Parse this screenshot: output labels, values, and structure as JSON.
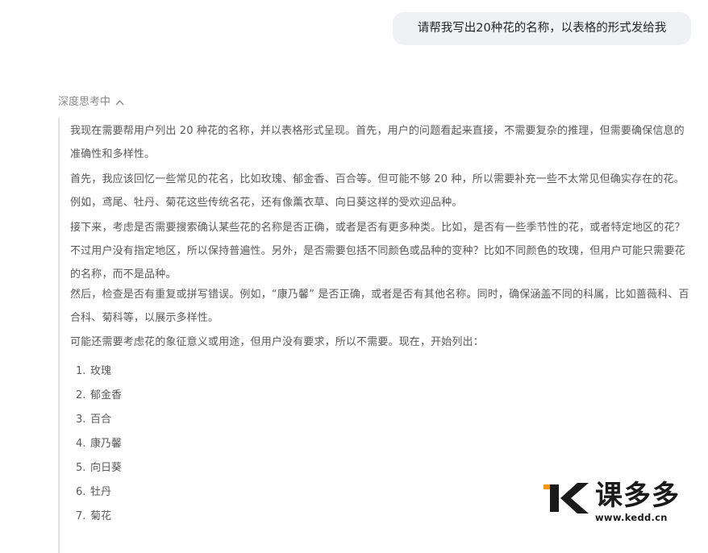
{
  "user_message": "请帮我写出20种花的名称，以表格的形式发给我",
  "thinking": {
    "header": "深度思考中",
    "paragraphs": [
      "我现在需要帮用户列出 20 种花的名称，并以表格形式呈现。首先，用户的问题看起来直接，不需要复杂的推理，但需要确保信息的准确性和多样性。",
      "首先，我应该回忆一些常见的花名，比如玫瑰、郁金香、百合等。但可能不够 20 种，所以需要补充一些不太常见但确实存在的花。例如，鸢尾、牡丹、菊花这些传统名花，还有像薰衣草、向日葵这样的受欢迎品种。",
      "接下来，考虑是否需要搜索确认某些花的名称是否正确，或者是否有更多种类。比如，是否有一些季节性的花，或者特定地区的花？不过用户没有指定地区，所以保持普遍性。另外，是否需要包括不同颜色或品种的变种？比如不同颜色的玫瑰，但用户可能只需要花的名称，而不是品种。",
      "然后，检查是否有重复或拼写错误。例如，“康乃馨” 是否正确，或者是否有其他名称。同时，确保涵盖不同的科属，比如蔷薇科、百合科、菊科等，以展示多样性。",
      "可能还需要考虑花的象征意义或用途，但用户没有要求，所以不需要。现在，开始列出："
    ],
    "list": [
      {
        "num": "1.",
        "name": "玫瑰"
      },
      {
        "num": "2.",
        "name": "郁金香"
      },
      {
        "num": "3.",
        "name": "百合"
      },
      {
        "num": "4.",
        "name": "康乃馨"
      },
      {
        "num": "5.",
        "name": "向日葵"
      },
      {
        "num": "6.",
        "name": "牡丹"
      },
      {
        "num": "7.",
        "name": "菊花"
      }
    ]
  },
  "watermark": {
    "brand": "课多多",
    "url": "www.kedd.cn",
    "accent_color": "#f39800"
  },
  "colors": {
    "bubble_bg": "#eff1f5",
    "think_border": "#e3e3e3",
    "think_text": "#5a5a5a",
    "muted": "#8b8b8b"
  },
  "icons": {
    "collapse": "chevron-up-icon",
    "logo": "k-logo-icon"
  }
}
